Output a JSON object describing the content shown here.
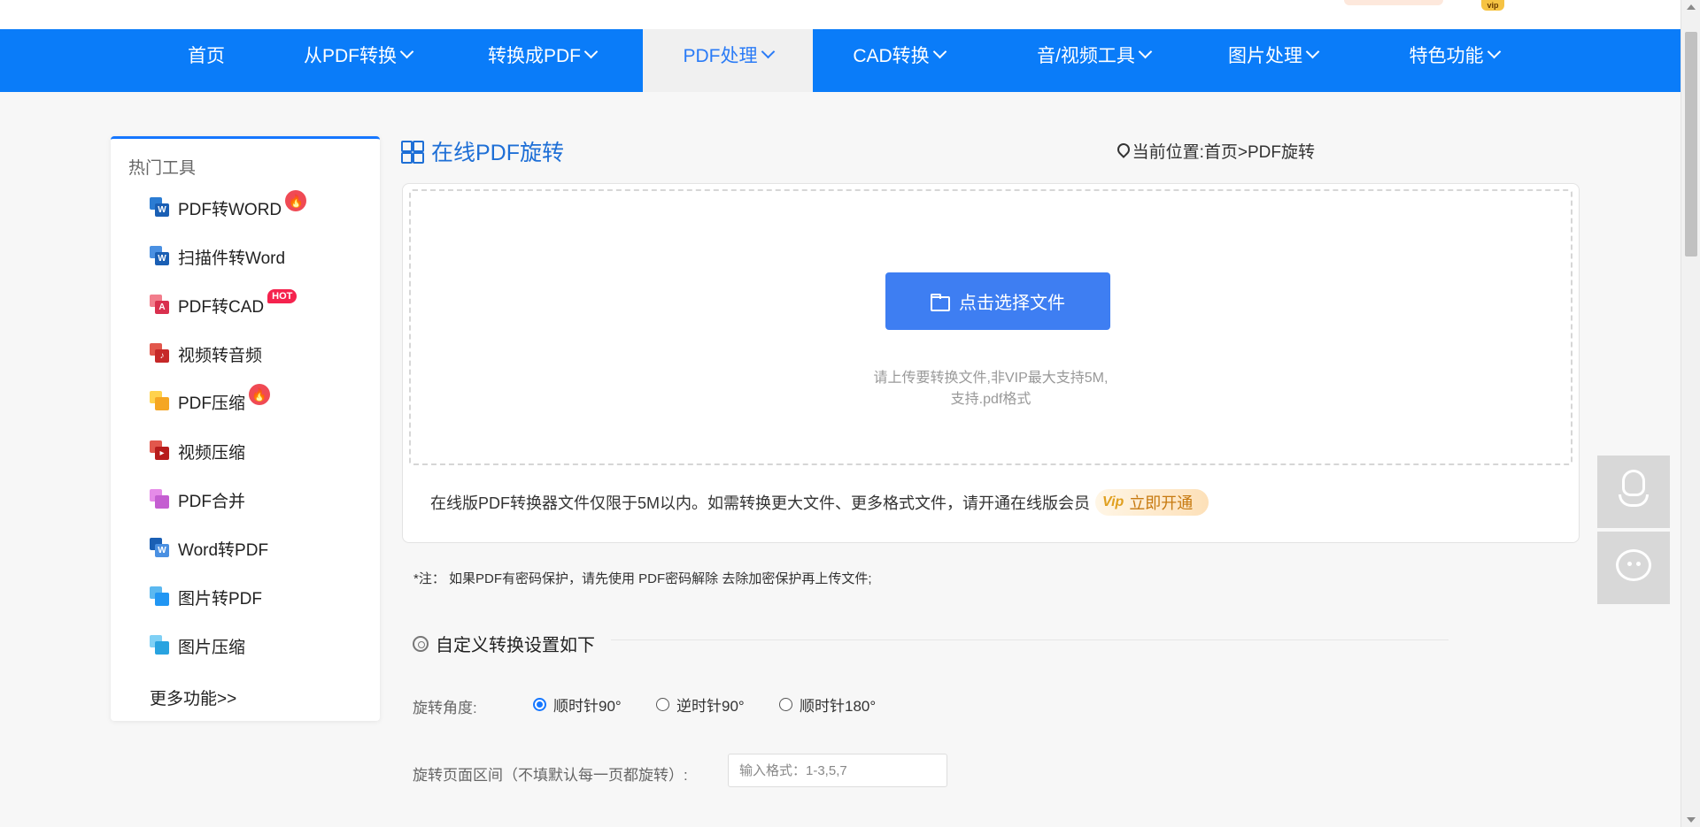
{
  "topbar": {
    "vip_badge": "vip"
  },
  "nav": {
    "items": [
      {
        "label": "首页"
      },
      {
        "label": "从PDF转换"
      },
      {
        "label": "转换成PDF"
      },
      {
        "label": "PDF处理"
      },
      {
        "label": "CAD转换"
      },
      {
        "label": "音/视频工具"
      },
      {
        "label": "图片处理"
      },
      {
        "label": "特色功能"
      }
    ],
    "active": "PDF处理",
    "background": "#0a7cf9"
  },
  "sidebar": {
    "heading": "热门工具",
    "items": [
      {
        "label": "PDF转WORD",
        "icon": "pdf-to-word-icon",
        "badge": "fire"
      },
      {
        "label": "扫描件转Word",
        "icon": "scan-to-word-icon"
      },
      {
        "label": "PDF转CAD",
        "icon": "pdf-to-cad-icon",
        "badge": "HOT"
      },
      {
        "label": "视频转音频",
        "icon": "video-to-audio-icon"
      },
      {
        "label": "PDF压缩",
        "icon": "pdf-compress-icon",
        "badge": "fire"
      },
      {
        "label": "视频压缩",
        "icon": "video-compress-icon"
      },
      {
        "label": "PDF合并",
        "icon": "pdf-merge-icon"
      },
      {
        "label": "Word转PDF",
        "icon": "word-to-pdf-icon"
      },
      {
        "label": "图片转PDF",
        "icon": "image-to-pdf-icon"
      },
      {
        "label": "图片压缩",
        "icon": "image-compress-icon"
      }
    ],
    "more": "更多功能>>"
  },
  "main": {
    "title": "在线PDF旋转",
    "location": "当前位置:首页>PDF旋转",
    "upload_button": "点击选择文件",
    "hint_line1": "请上传要转换文件,非VIP最大支持5M,",
    "hint_line2": "支持.pdf格式",
    "vip_note": "在线版PDF转换器文件仅限于5M以内。如需转换更大文件、更多格式文件，请开通在线版会员",
    "open_button": "立即开通",
    "open_button_mark": "Vip",
    "note": "*注： 如果PDF有密码保护，请先使用 PDF密码解除 去除加密保护再上传文件;",
    "settings_title": "自定义转换设置如下",
    "rotation_label": "旋转角度:",
    "rotation_options": [
      "顺时针90°",
      "逆时针90°",
      "顺时针180°"
    ],
    "rotation_selected": "顺时针90°",
    "range_label": "旋转页面区间（不填默认每一页都旋转）:",
    "range_placeholder": "输入格式：1-3,5,7"
  },
  "accent_color": "#3e7ef2"
}
